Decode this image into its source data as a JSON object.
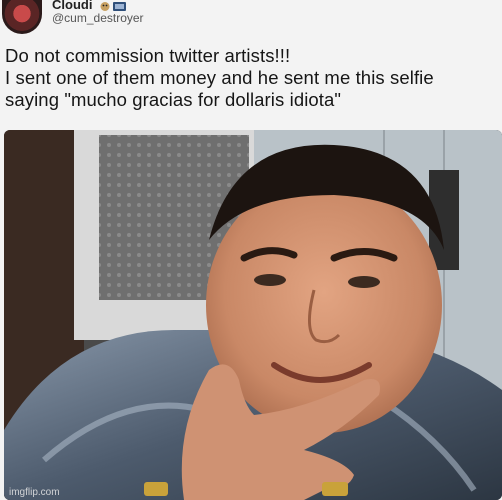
{
  "tweet": {
    "display_name": "Cloudi",
    "handle": "@cum_destroyer",
    "text_lines": [
      "Do not commission twitter artists!!!",
      "I sent one of them money and he sent me this selfie",
      "saying \"mucho gracias for dollaris idiota\""
    ]
  },
  "watermark": "imgflip.com",
  "icons": {
    "avatar": "profile-avatar",
    "badge": "emoji-badge-icon"
  }
}
